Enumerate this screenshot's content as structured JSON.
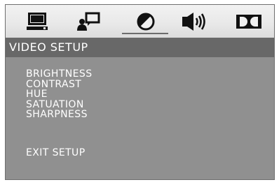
{
  "header": {
    "icons": [
      {
        "name": "system-setup-icon",
        "state": "inactive"
      },
      {
        "name": "language-setup-icon",
        "state": "inactive"
      },
      {
        "name": "video-setup-icon",
        "state": "selected"
      },
      {
        "name": "audio-setup-icon",
        "state": "inactive"
      },
      {
        "name": "dolby-digital-icon",
        "state": "inactive"
      }
    ]
  },
  "title": "VIDEO SETUP",
  "menu": {
    "items": [
      "BRIGHTNESS",
      "CONTRAST",
      "HUE",
      "SATUATION",
      "SHARPNESS"
    ],
    "exit": "EXIT SETUP"
  },
  "colors": {
    "panel": "#909090",
    "title_bar": "#686868",
    "text": "#ffffff",
    "icon": "#111111"
  }
}
